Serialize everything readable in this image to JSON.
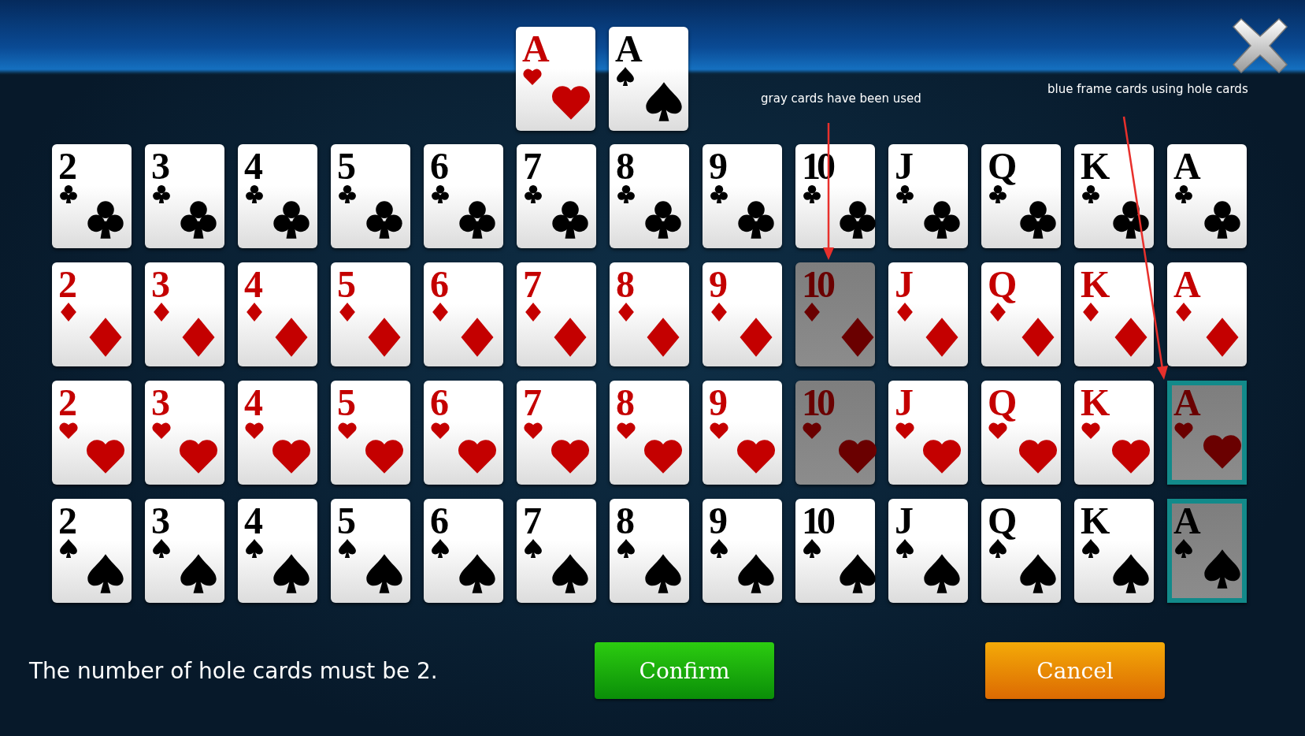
{
  "hole_cards": [
    {
      "rank": "A",
      "kind": "hearts"
    },
    {
      "rank": "A",
      "kind": "spades"
    }
  ],
  "annotations": [
    {
      "text": "gray cards have been used"
    },
    {
      "text": "blue frame cards using hole cards"
    }
  ],
  "rows": [
    {
      "kind": "clubs",
      "cards": [
        {
          "rank": "2",
          "used": false,
          "hole": false
        },
        {
          "rank": "3",
          "used": false,
          "hole": false
        },
        {
          "rank": "4",
          "used": false,
          "hole": false
        },
        {
          "rank": "5",
          "used": false,
          "hole": false
        },
        {
          "rank": "6",
          "used": false,
          "hole": false
        },
        {
          "rank": "7",
          "used": false,
          "hole": false
        },
        {
          "rank": "8",
          "used": false,
          "hole": false
        },
        {
          "rank": "9",
          "used": false,
          "hole": false
        },
        {
          "rank": "10",
          "used": false,
          "hole": false
        },
        {
          "rank": "J",
          "used": false,
          "hole": false
        },
        {
          "rank": "Q",
          "used": false,
          "hole": false
        },
        {
          "rank": "K",
          "used": false,
          "hole": false
        },
        {
          "rank": "A",
          "used": false,
          "hole": false
        }
      ]
    },
    {
      "kind": "diamonds",
      "cards": [
        {
          "rank": "2",
          "used": false,
          "hole": false
        },
        {
          "rank": "3",
          "used": false,
          "hole": false
        },
        {
          "rank": "4",
          "used": false,
          "hole": false
        },
        {
          "rank": "5",
          "used": false,
          "hole": false
        },
        {
          "rank": "6",
          "used": false,
          "hole": false
        },
        {
          "rank": "7",
          "used": false,
          "hole": false
        },
        {
          "rank": "8",
          "used": false,
          "hole": false
        },
        {
          "rank": "9",
          "used": false,
          "hole": false
        },
        {
          "rank": "10",
          "used": true,
          "hole": false
        },
        {
          "rank": "J",
          "used": false,
          "hole": false
        },
        {
          "rank": "Q",
          "used": false,
          "hole": false
        },
        {
          "rank": "K",
          "used": false,
          "hole": false
        },
        {
          "rank": "A",
          "used": false,
          "hole": false
        }
      ]
    },
    {
      "kind": "hearts",
      "cards": [
        {
          "rank": "2",
          "used": false,
          "hole": false
        },
        {
          "rank": "3",
          "used": false,
          "hole": false
        },
        {
          "rank": "4",
          "used": false,
          "hole": false
        },
        {
          "rank": "5",
          "used": false,
          "hole": false
        },
        {
          "rank": "6",
          "used": false,
          "hole": false
        },
        {
          "rank": "7",
          "used": false,
          "hole": false
        },
        {
          "rank": "8",
          "used": false,
          "hole": false
        },
        {
          "rank": "9",
          "used": false,
          "hole": false
        },
        {
          "rank": "10",
          "used": true,
          "hole": false
        },
        {
          "rank": "J",
          "used": false,
          "hole": false
        },
        {
          "rank": "Q",
          "used": false,
          "hole": false
        },
        {
          "rank": "K",
          "used": false,
          "hole": false
        },
        {
          "rank": "A",
          "used": true,
          "hole": true
        }
      ]
    },
    {
      "kind": "spades",
      "cards": [
        {
          "rank": "2",
          "used": false,
          "hole": false
        },
        {
          "rank": "3",
          "used": false,
          "hole": false
        },
        {
          "rank": "4",
          "used": false,
          "hole": false
        },
        {
          "rank": "5",
          "used": false,
          "hole": false
        },
        {
          "rank": "6",
          "used": false,
          "hole": false
        },
        {
          "rank": "7",
          "used": false,
          "hole": false
        },
        {
          "rank": "8",
          "used": false,
          "hole": false
        },
        {
          "rank": "9",
          "used": false,
          "hole": false
        },
        {
          "rank": "10",
          "used": false,
          "hole": false
        },
        {
          "rank": "J",
          "used": false,
          "hole": false
        },
        {
          "rank": "Q",
          "used": false,
          "hole": false
        },
        {
          "rank": "K",
          "used": false,
          "hole": false
        },
        {
          "rank": "A",
          "used": true,
          "hole": true
        }
      ]
    }
  ],
  "message": "The number of hole cards must be 2.",
  "buttons": [
    {
      "label": "Confirm",
      "kind": "confirm"
    },
    {
      "label": "Cancel",
      "kind": "cancel"
    }
  ]
}
